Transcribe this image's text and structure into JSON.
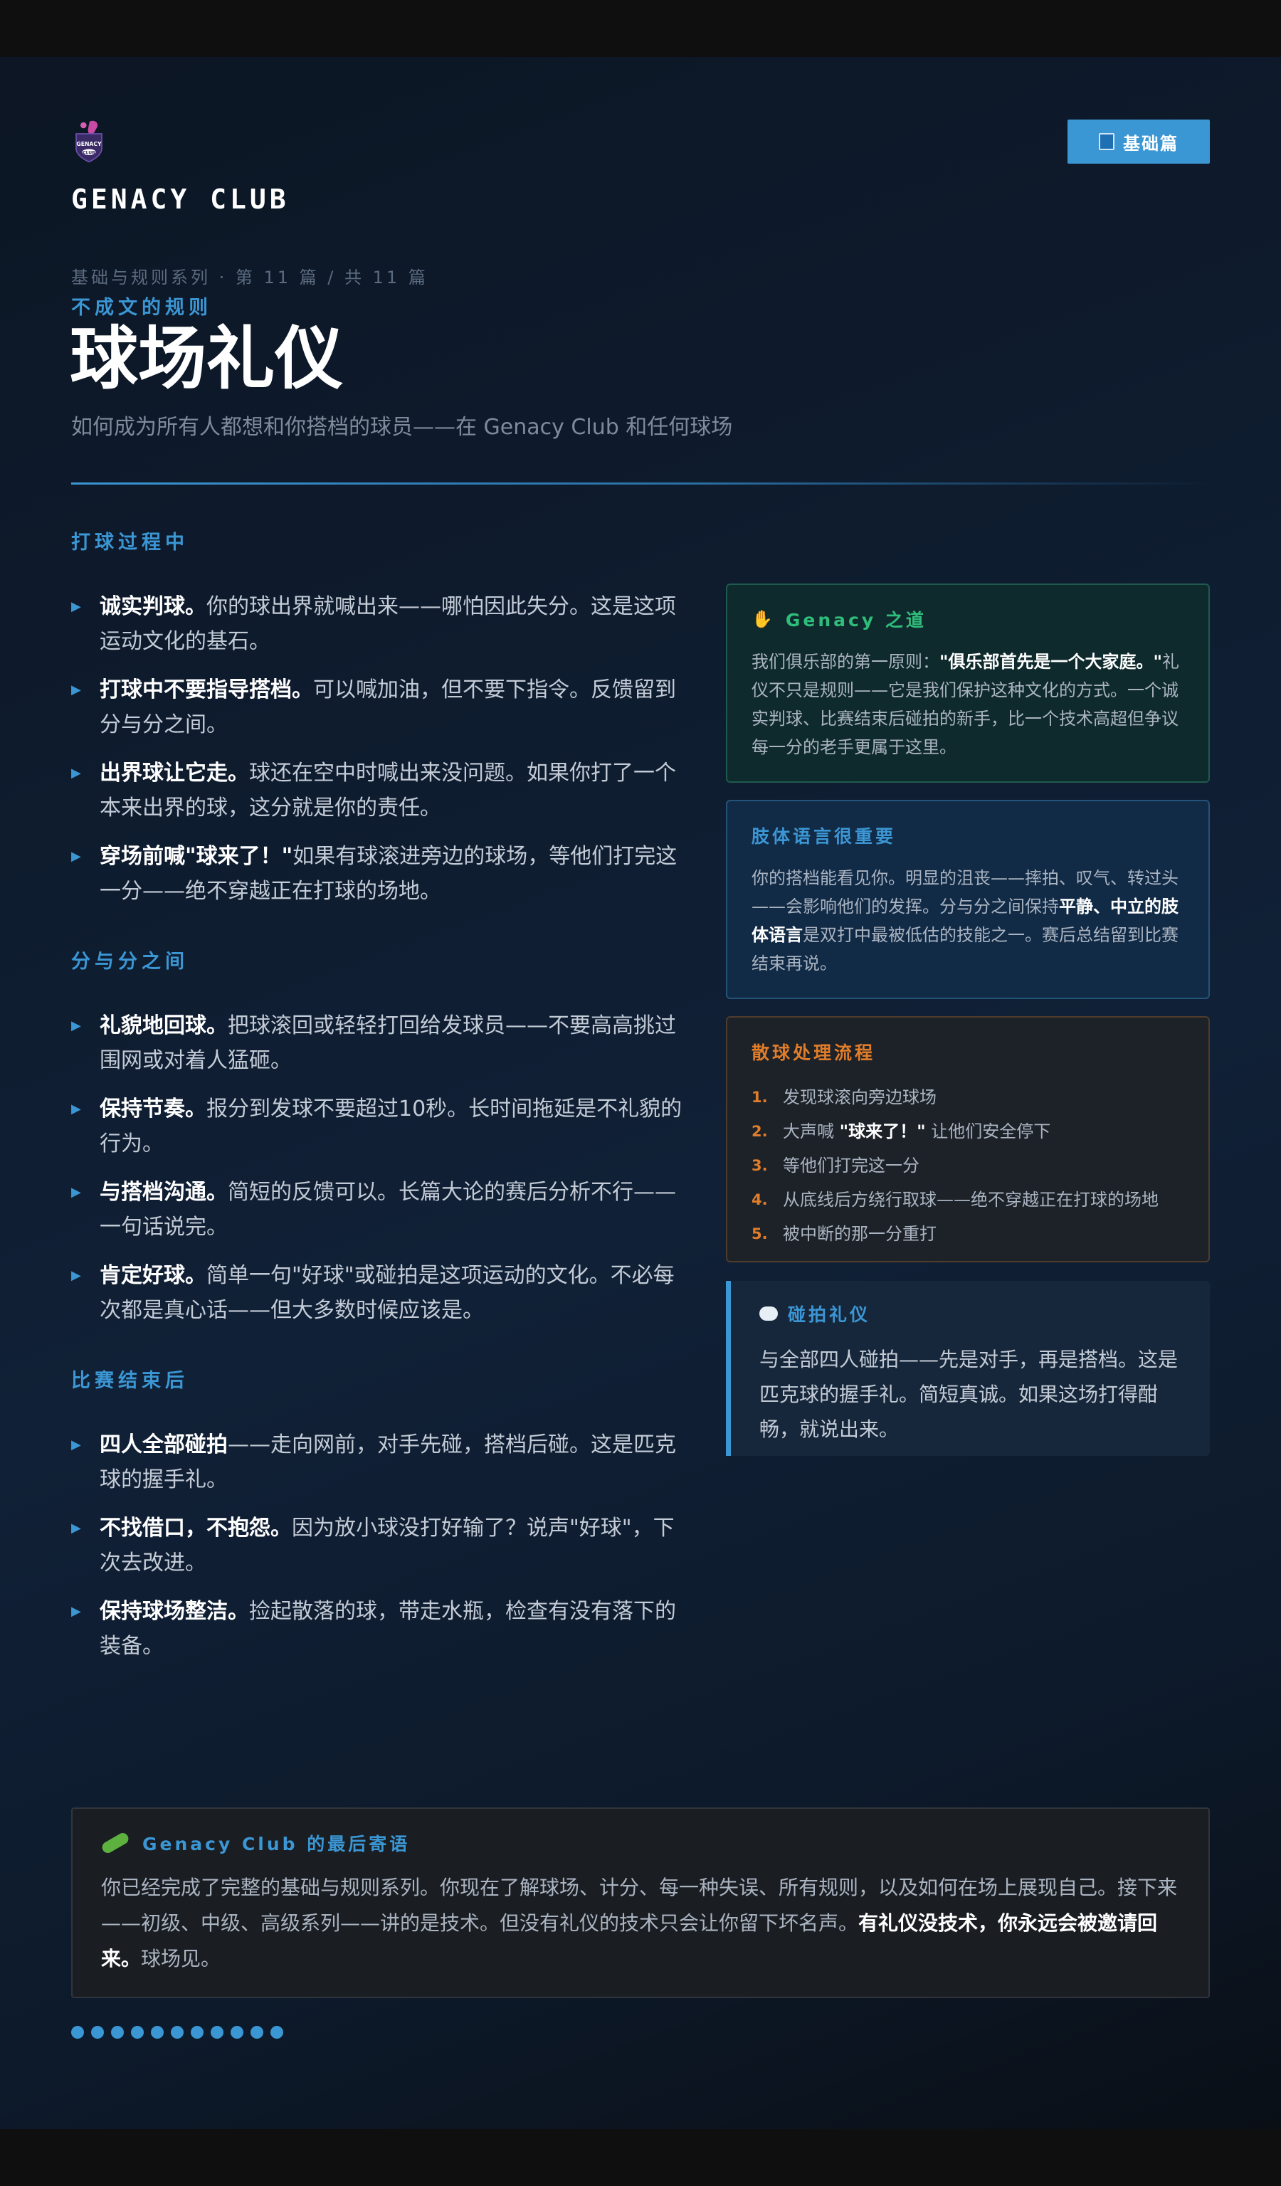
{
  "header": {
    "brand": "GENACY CLUB",
    "badge_label": "基础篇",
    "logo_text_top": "GENACY",
    "logo_text_bottom": "CLUB"
  },
  "hero": {
    "series": "基础与规则系列 · 第 11 篇 / 共 11 篇",
    "kicker": "不成文的规则",
    "title": "球场礼仪",
    "subtitle": "如何成为所有人都想和你搭档的球员——在 Genacy Club 和任何球场"
  },
  "sections": [
    {
      "heading": "打球过程中",
      "items": [
        {
          "bold": "诚实判球。",
          "text": "你的球出界就喊出来——哪怕因此失分。这是这项运动文化的基石。"
        },
        {
          "bold": "打球中不要指导搭档。",
          "text": "可以喊加油，但不要下指令。反馈留到分与分之间。"
        },
        {
          "bold": "出界球让它走。",
          "text": "球还在空中时喊出来没问题。如果你打了一个本来出界的球，这分就是你的责任。"
        },
        {
          "bold": "穿场前喊\"球来了！\"",
          "text": "如果有球滚进旁边的球场，等他们打完这一分——绝不穿越正在打球的场地。"
        }
      ]
    },
    {
      "heading": "分与分之间",
      "items": [
        {
          "bold": "礼貌地回球。",
          "text": "把球滚回或轻轻打回给发球员——不要高高挑过围网或对着人猛砸。"
        },
        {
          "bold": "保持节奏。",
          "text": "报分到发球不要超过10秒。长时间拖延是不礼貌的行为。"
        },
        {
          "bold": "与搭档沟通。",
          "text": "简短的反馈可以。长篇大论的赛后分析不行——一句话说完。"
        },
        {
          "bold": "肯定好球。",
          "text": "简单一句\"好球\"或碰拍是这项运动的文化。不必每次都是真心话——但大多数时候应该是。"
        }
      ]
    },
    {
      "heading": "比赛结束后",
      "items": [
        {
          "bold": "四人全部碰拍",
          "text": "——走向网前，对手先碰，搭档后碰。这是匹克球的握手礼。"
        },
        {
          "bold": "不找借口，不抱怨。",
          "text": "因为放小球没打好输了？说声\"好球\"，下次去改进。"
        },
        {
          "bold": "保持球场整洁。",
          "text": "捡起散落的球，带走水瓶，检查有没有落下的装备。"
        }
      ]
    }
  ],
  "cards": {
    "way": {
      "icon": "handshake-icon",
      "heading": "Genacy 之道",
      "pre": "我们俱乐部的第一原则：",
      "bold": "\"俱乐部首先是一个大家庭。\"",
      "post": "礼仪不只是规则——它是我们保护这种文化的方式。一个诚实判球、比赛结束后碰拍的新手，比一个技术高超但争议每一分的老手更属于这里。"
    },
    "body_language": {
      "heading": "肢体语言很重要",
      "pre": "你的搭档能看见你。明显的沮丧——摔拍、叹气、转过头——会影响他们的发挥。分与分之间保持",
      "bold": "平静、中立的肢体语言",
      "post": "是双打中最被低估的技能之一。赛后总结留到比赛结束再说。"
    },
    "stray_ball": {
      "heading": "散球处理流程",
      "steps": [
        {
          "num": "1.",
          "pre": "发现球滚向旁边球场",
          "bold": "",
          "post": ""
        },
        {
          "num": "2.",
          "pre": "大声喊 ",
          "bold": "\"球来了！\"",
          "post": " 让他们安全停下"
        },
        {
          "num": "3.",
          "pre": "等他们打完这一分",
          "bold": "",
          "post": ""
        },
        {
          "num": "4.",
          "pre": "从底线后方绕行取球——绝不穿越正在打球的场地",
          "bold": "",
          "post": ""
        },
        {
          "num": "5.",
          "pre": "被中断的那一分重打",
          "bold": "",
          "post": ""
        }
      ]
    },
    "paddle_tap": {
      "icon": "speech-bubble-icon",
      "heading": "碰拍礼仪",
      "text": "与全部四人碰拍——先是对手，再是搭档。这是匹克球的握手礼。简短真诚。如果这场打得酣畅，就说出来。"
    }
  },
  "final": {
    "icon": "paddle-icon",
    "heading": "Genacy Club 的最后寄语",
    "pre": "你已经完成了完整的基础与规则系列。你现在了解球场、计分、每一种失误、所有规则，以及如何在场上展现自己。接下来——初级、中级、高级系列——讲的是技术。但没有礼仪的技术只会让你留下坏名声。",
    "bold": "有礼仪没技术，你永远会被邀请回来。",
    "post": "球场见。"
  },
  "progress": {
    "completed": 11,
    "total": 11
  },
  "colors": {
    "accent": "#3b96d4",
    "green": "#2fbd7b",
    "orange": "#e07d2a",
    "logo_pink": "#c94aa3"
  }
}
